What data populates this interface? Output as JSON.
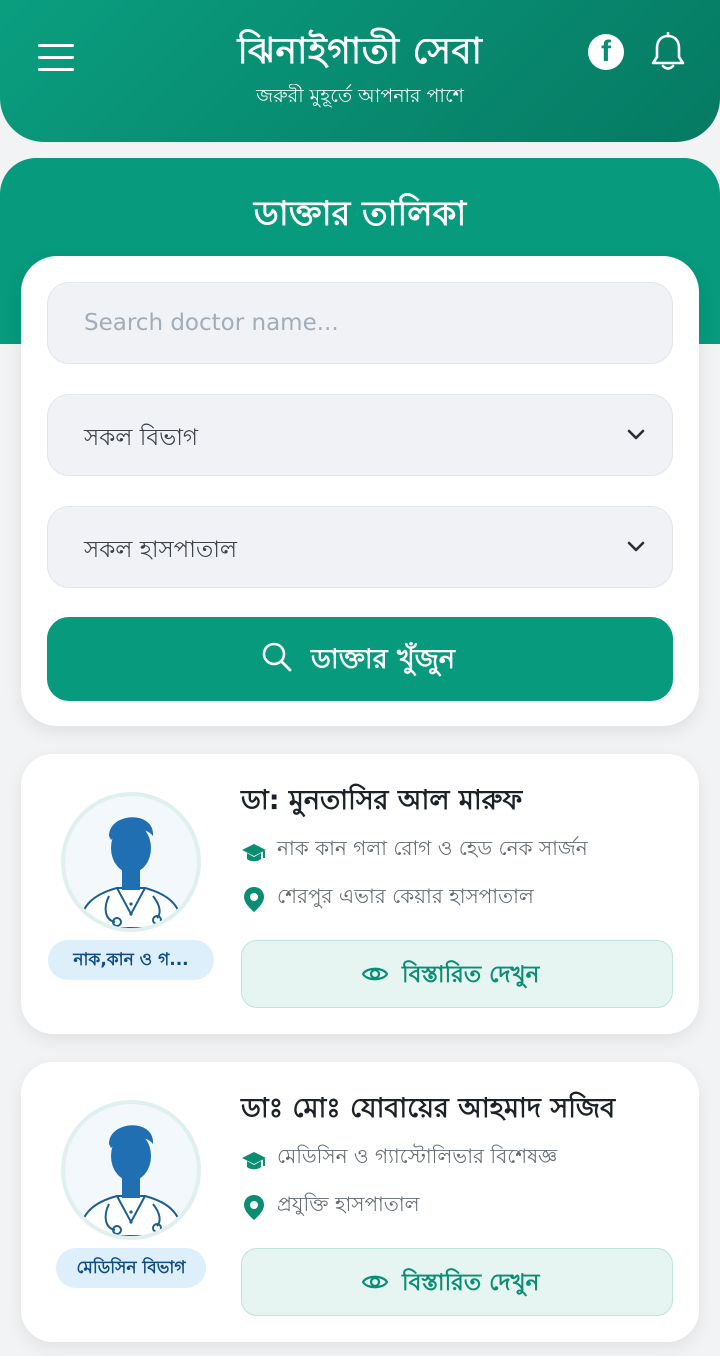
{
  "header": {
    "title": "ঝিনাইগাতী সেবা",
    "subtitle": "জরুরী মুহূর্তে আপনার পাশে",
    "menu_icon": "menu-icon",
    "facebook_icon": "facebook-icon",
    "bell_icon": "bell-icon"
  },
  "section": {
    "title": "ডাক্তার তালিকা"
  },
  "search": {
    "placeholder": "Search doctor name...",
    "department_select": "সকল বিভাগ",
    "hospital_select": "সকল হাসপাতাল",
    "button_label": "ডাক্তার খুঁজুন"
  },
  "doctors": [
    {
      "name": "ডা: মুনতাসির আল মারুফ",
      "specialty": "নাক কান গলা রোগ ও হেড নেক সার্জন",
      "hospital": "শেরপুর এভার কেয়ার হাসপাতাল",
      "badge": "নাক,কান ও গ...",
      "details_label": "বিস্তারিত দেখুন"
    },
    {
      "name": "ডাঃ মোঃ যোবায়ের আহমাদ সজিব",
      "specialty": "মেডিসিন ও গ্যাস্টোলিভার বিশেষজ্ঞ",
      "hospital": "প্রযুক্তি হাসপাতাল",
      "badge": "মেডিসিন বিভাগ",
      "details_label": "বিস্তারিত দেখুন"
    }
  ],
  "colors": {
    "primary": "#079a7c",
    "primary_dark": "#067a63",
    "badge_bg": "#ddeffb",
    "badge_text": "#0f4c81",
    "details_bg": "#e6f4f2"
  }
}
